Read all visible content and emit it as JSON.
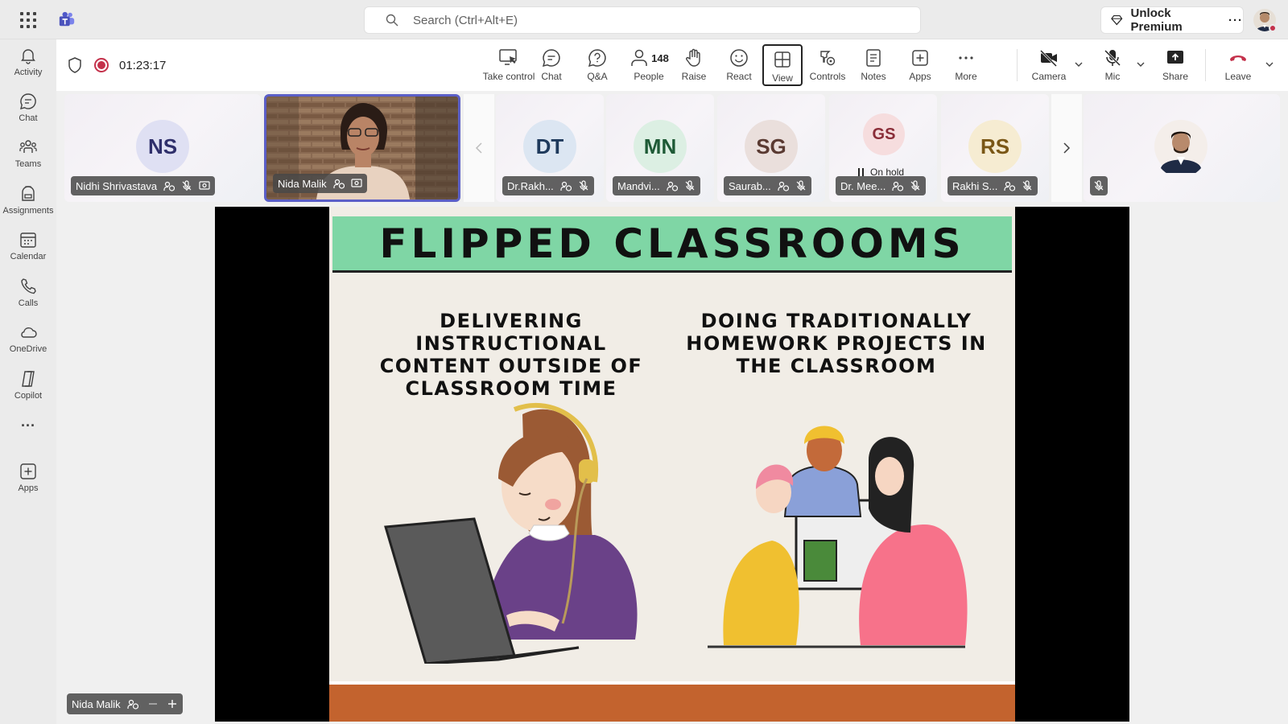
{
  "search": {
    "placeholder": "Search (Ctrl+Alt+E)"
  },
  "premium": {
    "label": "Unlock Premium",
    "more": "···"
  },
  "rail": [
    {
      "label": "Activity",
      "icon": "bell-icon"
    },
    {
      "label": "Chat",
      "icon": "chat-icon"
    },
    {
      "label": "Teams",
      "icon": "teams-icon"
    },
    {
      "label": "Assignments",
      "icon": "backpack-icon"
    },
    {
      "label": "Calendar",
      "icon": "calendar-icon"
    },
    {
      "label": "Calls",
      "icon": "phone-icon"
    },
    {
      "label": "OneDrive",
      "icon": "cloud-icon"
    },
    {
      "label": "Copilot",
      "icon": "copilot-icon"
    },
    {
      "label": "···",
      "icon": "more-icon"
    },
    {
      "label": "Apps",
      "icon": "add-apps-icon"
    }
  ],
  "meeting": {
    "timer": "01:23:17",
    "toolbar": {
      "take_control": "Take control",
      "chat": "Chat",
      "qa": "Q&A",
      "people": "People",
      "people_count": "148",
      "raise": "Raise",
      "react": "React",
      "view": "View",
      "controls": "Controls",
      "notes": "Notes",
      "apps": "Apps",
      "more": "More",
      "camera": "Camera",
      "mic": "Mic",
      "share": "Share",
      "leave": "Leave"
    }
  },
  "participants": [
    {
      "initials": "NS",
      "name": "Nidhi Shrivastava"
    },
    {
      "initials": "",
      "name": "Nida Malik"
    },
    {
      "initials": "DT",
      "name": "Dr.Rakh..."
    },
    {
      "initials": "MN",
      "name": "Mandvi..."
    },
    {
      "initials": "SG",
      "name": "Saurab..."
    },
    {
      "initials": "GS",
      "name": "Dr. Mee...",
      "status": "On hold"
    },
    {
      "initials": "RS",
      "name": "Rakhi S..."
    }
  ],
  "slide": {
    "title": "FLIPPED CLASSROOMS",
    "left_text": "DELIVERING INSTRUCTIONAL CONTENT OUTSIDE OF CLASSROOM TIME",
    "right_text": "DOING TRADITIONALLY HOMEWORK PROJECTS IN THE CLASSROOM"
  },
  "self_view": {
    "name": "Nida Malik"
  },
  "colors": {
    "accent": "#5b5fc7",
    "recording": "#c4314b",
    "banner": "#7fd6a5",
    "footer": "#c3632e",
    "leave": "#c4314b"
  }
}
